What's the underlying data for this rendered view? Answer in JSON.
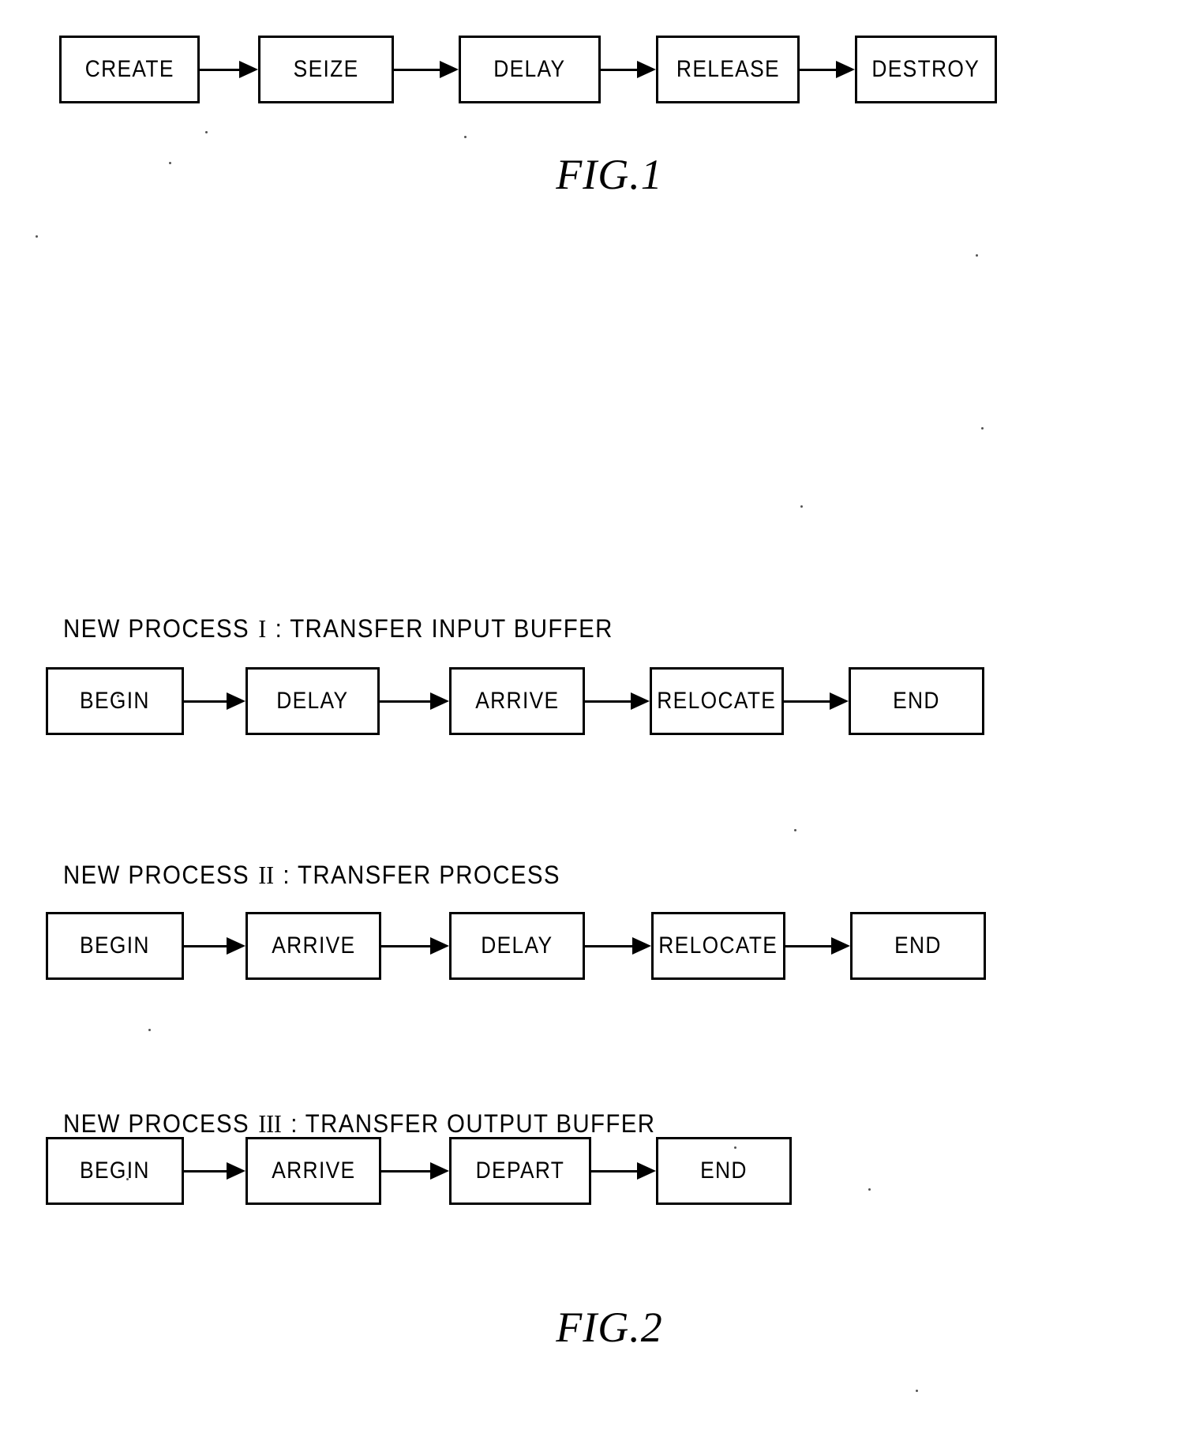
{
  "document": {
    "kind": "patent-figure-sheet",
    "background_color": "#ffffff",
    "ink_color": "#000000"
  },
  "figure1": {
    "caption": "FIG.1",
    "nodes": [
      {
        "label": "CREATE"
      },
      {
        "label": "SEIZE"
      },
      {
        "label": "DELAY"
      },
      {
        "label": "RELEASE"
      },
      {
        "label": "DESTROY"
      }
    ]
  },
  "figure2": {
    "caption": "FIG.2",
    "processes": [
      {
        "header_prefix": "NEW PROCESS",
        "roman": "I",
        "header_suffix": ": TRANSFER INPUT BUFFER",
        "header_full": "NEW PROCESS I : TRANSFER INPUT BUFFER",
        "nodes": [
          {
            "label": "BEGIN"
          },
          {
            "label": "DELAY"
          },
          {
            "label": "ARRIVE"
          },
          {
            "label": "RELOCATE"
          },
          {
            "label": "END"
          }
        ]
      },
      {
        "header_prefix": "NEW PROCESS",
        "roman": "II",
        "header_suffix": ": TRANSFER PROCESS",
        "header_full": "NEW PROCESS II : TRANSFER PROCESS",
        "nodes": [
          {
            "label": "BEGIN"
          },
          {
            "label": "ARRIVE"
          },
          {
            "label": "DELAY"
          },
          {
            "label": "RELOCATE"
          },
          {
            "label": "END"
          }
        ]
      },
      {
        "header_prefix": "NEW PROCESS",
        "roman": "III",
        "header_suffix": ": TRANSFER OUTPUT BUFFER",
        "header_full": "NEW PROCESS III : TRANSFER OUTPUT BUFFER",
        "nodes": [
          {
            "label": "BEGIN"
          },
          {
            "label": "ARRIVE"
          },
          {
            "label": "DEPART"
          },
          {
            "label": "END"
          }
        ]
      }
    ]
  }
}
